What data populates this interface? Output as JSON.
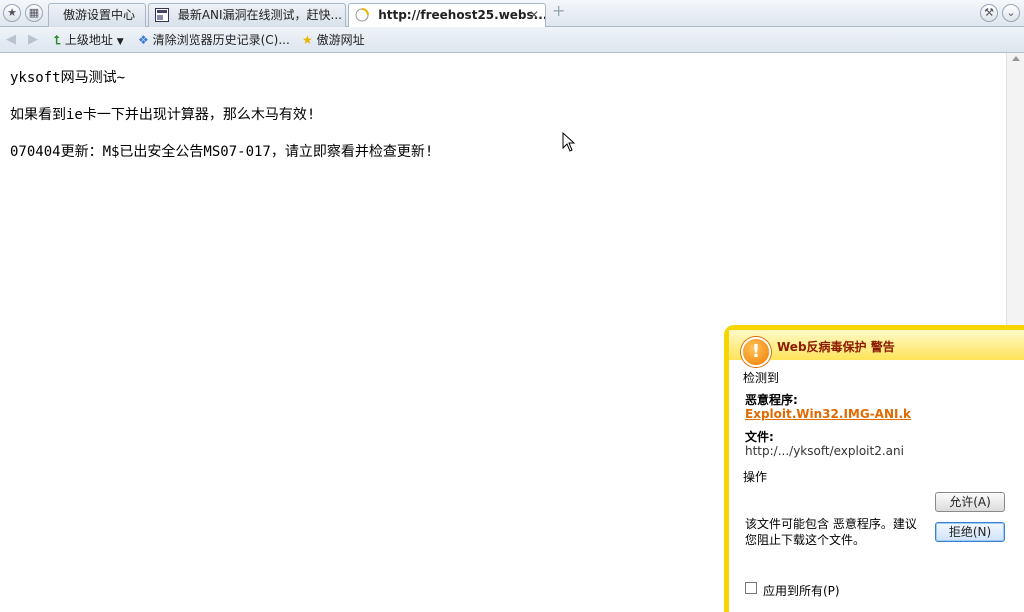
{
  "browser": {
    "tabs": [
      {
        "label": "傲游设置中心",
        "active": false
      },
      {
        "label": "最新ANI漏洞在线测试，赶快...",
        "active": false
      },
      {
        "label": "http://freehost25.webs...",
        "active": true
      }
    ],
    "toolbar": {
      "up_label": "上级地址",
      "clear_history_label": "清除浏览器历史记录(C)...",
      "favorites_label": "傲游网址"
    }
  },
  "page": {
    "line1": "yksoft网马测试~",
    "line2": "如果看到ie卡一下并出现计算器，那么木马有效!",
    "line3": "070404更新：M$已出安全公告MS07-017，请立即察看并检查更新!"
  },
  "popup": {
    "title": "Web反病毒保护 警告",
    "detected_label": "检测到",
    "malware_label": "恶意程序:",
    "malware_name": "Exploit.Win32.IMG-ANI.k",
    "file_label": "文件:",
    "file_path": "http:/.../yksoft/exploit2.ani",
    "action_label": "操作",
    "description": "该文件可能包含 恶意程序。建议您阻止下载这个文件。",
    "allow_button": "允许(A)",
    "deny_button": "拒绝(N)",
    "apply_all_label": "应用到所有(P)"
  }
}
